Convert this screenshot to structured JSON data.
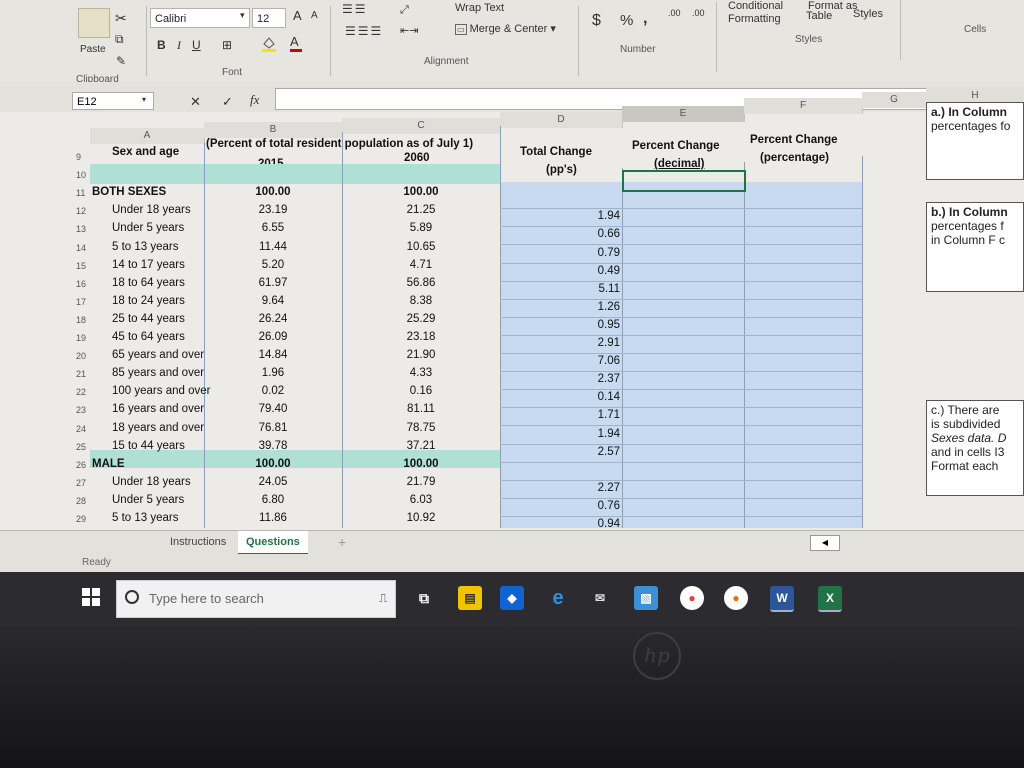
{
  "ribbon": {
    "font_name": "Calibri",
    "font_size": "12",
    "grow_font": "A",
    "shrink_font": "A",
    "bold": "B",
    "italic": "I",
    "underline": "U",
    "wrap_text": "Wrap Text",
    "merge_center": "Merge & Center",
    "currency": "$",
    "percent": "%",
    "comma": ",",
    "inc_dec": ".00",
    "dec_dec": ".00",
    "conditional_formatting": "Conditional\nFormatting",
    "format_as": "Format as",
    "table": "Table",
    "cell_styles": "Styles",
    "paste": "Paste",
    "groups": {
      "clipboard": "Clipboard",
      "font": "Font",
      "alignment": "Alignment",
      "number": "Number",
      "styles": "Styles",
      "cells": "Cells"
    }
  },
  "formula_bar": {
    "name_box": "E12",
    "fx": "fx",
    "cancel": "✕",
    "enter": "✓",
    "value": ""
  },
  "columns": [
    "A",
    "B",
    "C",
    "D",
    "E",
    "F",
    "G",
    "H"
  ],
  "header": {
    "a": "Sex and age",
    "bc": "(Percent of total resident population as of July 1)",
    "b": "2015",
    "c": "2060",
    "d1": "Total Change",
    "d2": "(pp's)",
    "e1": "Percent Change",
    "e2": "(decimal)",
    "f1": "Percent Change",
    "f2": "(percentage)"
  },
  "rows": [
    {
      "num": "9",
      "a": "",
      "b": "",
      "c": "",
      "d": ""
    },
    {
      "num": "10",
      "a": "",
      "b": "",
      "c": "",
      "d": ""
    },
    {
      "num": "11",
      "a": "BOTH SEXES",
      "b": "100.00",
      "c": "100.00",
      "d": ""
    },
    {
      "num": "12",
      "a": "Under 18 years",
      "b": "23.19",
      "c": "21.25",
      "d": "1.94"
    },
    {
      "num": "13",
      "a": "Under 5 years",
      "b": "6.55",
      "c": "5.89",
      "d": "0.66"
    },
    {
      "num": "14",
      "a": "5 to 13 years",
      "b": "11.44",
      "c": "10.65",
      "d": "0.79"
    },
    {
      "num": "15",
      "a": "14 to 17 years",
      "b": "5.20",
      "c": "4.71",
      "d": "0.49"
    },
    {
      "num": "16",
      "a": "18 to 64 years",
      "b": "61.97",
      "c": "56.86",
      "d": "5.11"
    },
    {
      "num": "17",
      "a": "18 to 24 years",
      "b": "9.64",
      "c": "8.38",
      "d": "1.26"
    },
    {
      "num": "18",
      "a": "25 to 44 years",
      "b": "26.24",
      "c": "25.29",
      "d": "0.95"
    },
    {
      "num": "19",
      "a": "45 to 64 years",
      "b": "26.09",
      "c": "23.18",
      "d": "2.91"
    },
    {
      "num": "20",
      "a": "65 years and over",
      "b": "14.84",
      "c": "21.90",
      "d": "7.06"
    },
    {
      "num": "21",
      "a": "85 years and over",
      "b": "1.96",
      "c": "4.33",
      "d": "2.37"
    },
    {
      "num": "22",
      "a": "100 years and over",
      "b": "0.02",
      "c": "0.16",
      "d": "0.14"
    },
    {
      "num": "23",
      "a": "16 years and over",
      "b": "79.40",
      "c": "81.11",
      "d": "1.71"
    },
    {
      "num": "24",
      "a": "18 years and over",
      "b": "76.81",
      "c": "78.75",
      "d": "1.94"
    },
    {
      "num": "25",
      "a": "15 to 44 years",
      "b": "39.78",
      "c": "37.21",
      "d": "2.57"
    },
    {
      "num": "26",
      "a": "MALE",
      "b": "100.00",
      "c": "100.00",
      "d": ""
    },
    {
      "num": "27",
      "a": "Under 18 years",
      "b": "24.05",
      "c": "21.79",
      "d": "2.27"
    },
    {
      "num": "28",
      "a": "Under 5 years",
      "b": "6.80",
      "c": "6.03",
      "d": "0.76"
    },
    {
      "num": "29",
      "a": "5 to 13 years",
      "b": "11.86",
      "c": "10.92",
      "d": "0.94"
    }
  ],
  "notes": {
    "a_title": "a.) In Column",
    "a_line2": "percentages fo",
    "b_title": "b.) In Column",
    "b_line2": "percentages f",
    "b_line3": "in Column F c",
    "c_title": "c.) There are",
    "c_line2": "is subdivided",
    "c_line3": "Sexes data. D",
    "c_line4": "and in cells I3",
    "c_line5": "Format each"
  },
  "sheet_tabs": {
    "instructions": "Instructions",
    "questions": "Questions",
    "add": "+"
  },
  "status": {
    "ready": "Ready"
  },
  "taskbar": {
    "search_placeholder": "Type here to search"
  },
  "brand": "hp",
  "colors": {
    "teal_band": "#aee0d6",
    "blue_column": "#c7daef",
    "excel_green": "#217346"
  }
}
